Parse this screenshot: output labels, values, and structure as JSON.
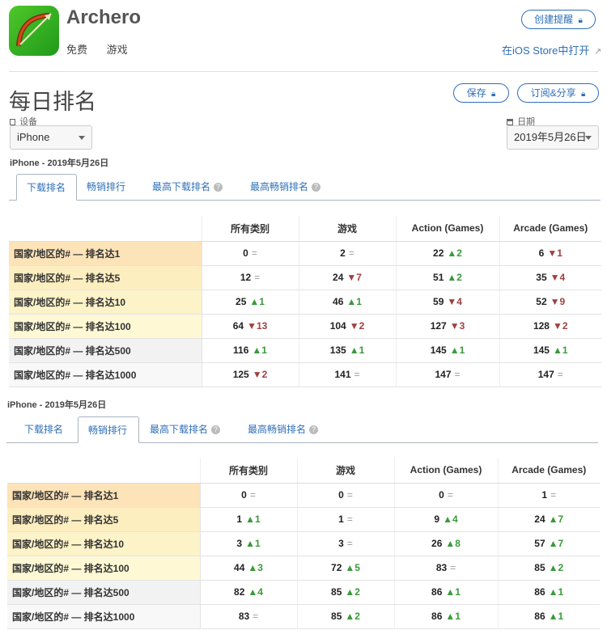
{
  "app": {
    "name": "Archero",
    "price": "免费",
    "category": "游戏"
  },
  "header": {
    "create_alert": "创建提醒",
    "open_store": "在iOS Store中打开"
  },
  "page": {
    "title": "每日排名",
    "save_label": "保存",
    "subscribe_label": "订阅&分享",
    "device_label": "设备",
    "device_value": "iPhone",
    "date_label": "日期",
    "date_value": "2019年5月26日"
  },
  "sections": [
    {
      "label": "iPhone - 2019年5月26日",
      "tabs": [
        "下载排名",
        "畅销排行",
        "最高下载排名",
        "最高畅销排名"
      ],
      "active_tab": 0,
      "columns": [
        "所有类别",
        "游戏",
        "Action (Games)",
        "Arcade (Games)"
      ],
      "rows": [
        {
          "label": "国家/地区的# — 排名达1",
          "bg": "#fde3b8",
          "cells": [
            {
              "v": "0",
              "d": "=",
              "t": "eq"
            },
            {
              "v": "2",
              "d": "=",
              "t": "eq"
            },
            {
              "v": "22",
              "d": "▲2",
              "t": "up"
            },
            {
              "v": "6",
              "d": "▼1",
              "t": "down"
            }
          ]
        },
        {
          "label": "国家/地区的# — 排名达5",
          "bg": "#fdeec0",
          "cells": [
            {
              "v": "12",
              "d": "=",
              "t": "eq"
            },
            {
              "v": "24",
              "d": "▼7",
              "t": "down"
            },
            {
              "v": "51",
              "d": "▲2",
              "t": "up"
            },
            {
              "v": "35",
              "d": "▼4",
              "t": "down"
            }
          ]
        },
        {
          "label": "国家/地区的# — 排名达10",
          "bg": "#fdf3c8",
          "cells": [
            {
              "v": "25",
              "d": "▲1",
              "t": "up"
            },
            {
              "v": "46",
              "d": "▲1",
              "t": "up"
            },
            {
              "v": "59",
              "d": "▼4",
              "t": "down"
            },
            {
              "v": "52",
              "d": "▼9",
              "t": "down"
            }
          ]
        },
        {
          "label": "国家/地区的# — 排名达100",
          "bg": "#fef9d4",
          "cells": [
            {
              "v": "64",
              "d": "▼13",
              "t": "down"
            },
            {
              "v": "104",
              "d": "▼2",
              "t": "down"
            },
            {
              "v": "127",
              "d": "▼3",
              "t": "down"
            },
            {
              "v": "128",
              "d": "▼2",
              "t": "down"
            }
          ]
        },
        {
          "label": "国家/地区的# — 排名达500",
          "bg": "#f2f2f2",
          "cells": [
            {
              "v": "116",
              "d": "▲1",
              "t": "up"
            },
            {
              "v": "135",
              "d": "▲1",
              "t": "up"
            },
            {
              "v": "145",
              "d": "▲1",
              "t": "up"
            },
            {
              "v": "145",
              "d": "▲1",
              "t": "up"
            }
          ]
        },
        {
          "label": "国家/地区的# — 排名达1000",
          "bg": "#f8f8f8",
          "cells": [
            {
              "v": "125",
              "d": "▼2",
              "t": "down"
            },
            {
              "v": "141",
              "d": "=",
              "t": "eq"
            },
            {
              "v": "147",
              "d": "=",
              "t": "eq"
            },
            {
              "v": "147",
              "d": "=",
              "t": "eq"
            }
          ]
        }
      ]
    },
    {
      "label": "iPhone - 2019年5月26日",
      "tabs": [
        "下载排名",
        "畅销排行",
        "最高下载排名",
        "最高畅销排名"
      ],
      "active_tab": 1,
      "columns": [
        "所有类别",
        "游戏",
        "Action (Games)",
        "Arcade (Games)"
      ],
      "rows": [
        {
          "label": "国家/地区的# — 排名达1",
          "bg": "#fde3b8",
          "cells": [
            {
              "v": "0",
              "d": "=",
              "t": "eq"
            },
            {
              "v": "0",
              "d": "=",
              "t": "eq"
            },
            {
              "v": "0",
              "d": "=",
              "t": "eq"
            },
            {
              "v": "1",
              "d": "=",
              "t": "eq"
            }
          ]
        },
        {
          "label": "国家/地区的# — 排名达5",
          "bg": "#fdeec0",
          "cells": [
            {
              "v": "1",
              "d": "▲1",
              "t": "up"
            },
            {
              "v": "1",
              "d": "=",
              "t": "eq"
            },
            {
              "v": "9",
              "d": "▲4",
              "t": "up"
            },
            {
              "v": "24",
              "d": "▲7",
              "t": "up"
            }
          ]
        },
        {
          "label": "国家/地区的# — 排名达10",
          "bg": "#fdf3c8",
          "cells": [
            {
              "v": "3",
              "d": "▲1",
              "t": "up"
            },
            {
              "v": "3",
              "d": "=",
              "t": "eq"
            },
            {
              "v": "26",
              "d": "▲8",
              "t": "up"
            },
            {
              "v": "57",
              "d": "▲7",
              "t": "up"
            }
          ]
        },
        {
          "label": "国家/地区的# — 排名达100",
          "bg": "#fef9d4",
          "cells": [
            {
              "v": "44",
              "d": "▲3",
              "t": "up"
            },
            {
              "v": "72",
              "d": "▲5",
              "t": "up"
            },
            {
              "v": "83",
              "d": "=",
              "t": "eq"
            },
            {
              "v": "85",
              "d": "▲2",
              "t": "up"
            }
          ]
        },
        {
          "label": "国家/地区的# — 排名达500",
          "bg": "#f2f2f2",
          "cells": [
            {
              "v": "82",
              "d": "▲4",
              "t": "up"
            },
            {
              "v": "85",
              "d": "▲2",
              "t": "up"
            },
            {
              "v": "86",
              "d": "▲1",
              "t": "up"
            },
            {
              "v": "86",
              "d": "▲1",
              "t": "up"
            }
          ]
        },
        {
          "label": "国家/地区的# — 排名达1000",
          "bg": "#f8f8f8",
          "cells": [
            {
              "v": "83",
              "d": "=",
              "t": "eq"
            },
            {
              "v": "85",
              "d": "▲2",
              "t": "up"
            },
            {
              "v": "86",
              "d": "▲1",
              "t": "up"
            },
            {
              "v": "86",
              "d": "▲1",
              "t": "up"
            }
          ]
        }
      ]
    }
  ],
  "colors": {
    "accent": "#2f6fb7",
    "up": "#3a9a3a",
    "down": "#a04040"
  }
}
